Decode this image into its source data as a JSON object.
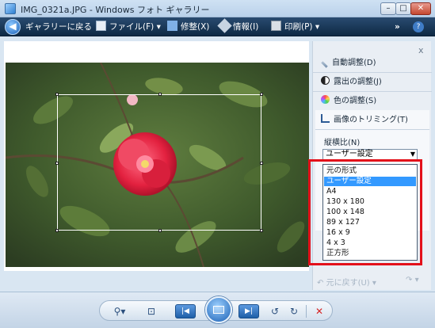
{
  "window": {
    "title": "IMG_0321a.JPG - Windows フォト ギャラリー"
  },
  "toolbar": {
    "back": "ギャラリーに戻る",
    "file": "ファイル(F)",
    "fix": "修整(X)",
    "info": "情報(I)",
    "print": "印刷(P)"
  },
  "pane": {
    "auto_adjust": "自動調整(D)",
    "exposure": "露出の調整(J)",
    "color": "色の調整(S)",
    "trim": "画像のトリミング(T)",
    "aspect_label": "縦横比(N)",
    "aspect_value": "ユーザー設定",
    "options": [
      "元の形式",
      "ユーザー設定",
      "A4",
      "130 x 180",
      "100 x 148",
      "89 x 127",
      "16 x 9",
      "4 x 3",
      "正方形"
    ],
    "undo": "元に戻す(U)"
  },
  "colors": {
    "highlight": "#3399ff",
    "redframe": "#e3101a",
    "toolbar": "#1b3a5c"
  }
}
